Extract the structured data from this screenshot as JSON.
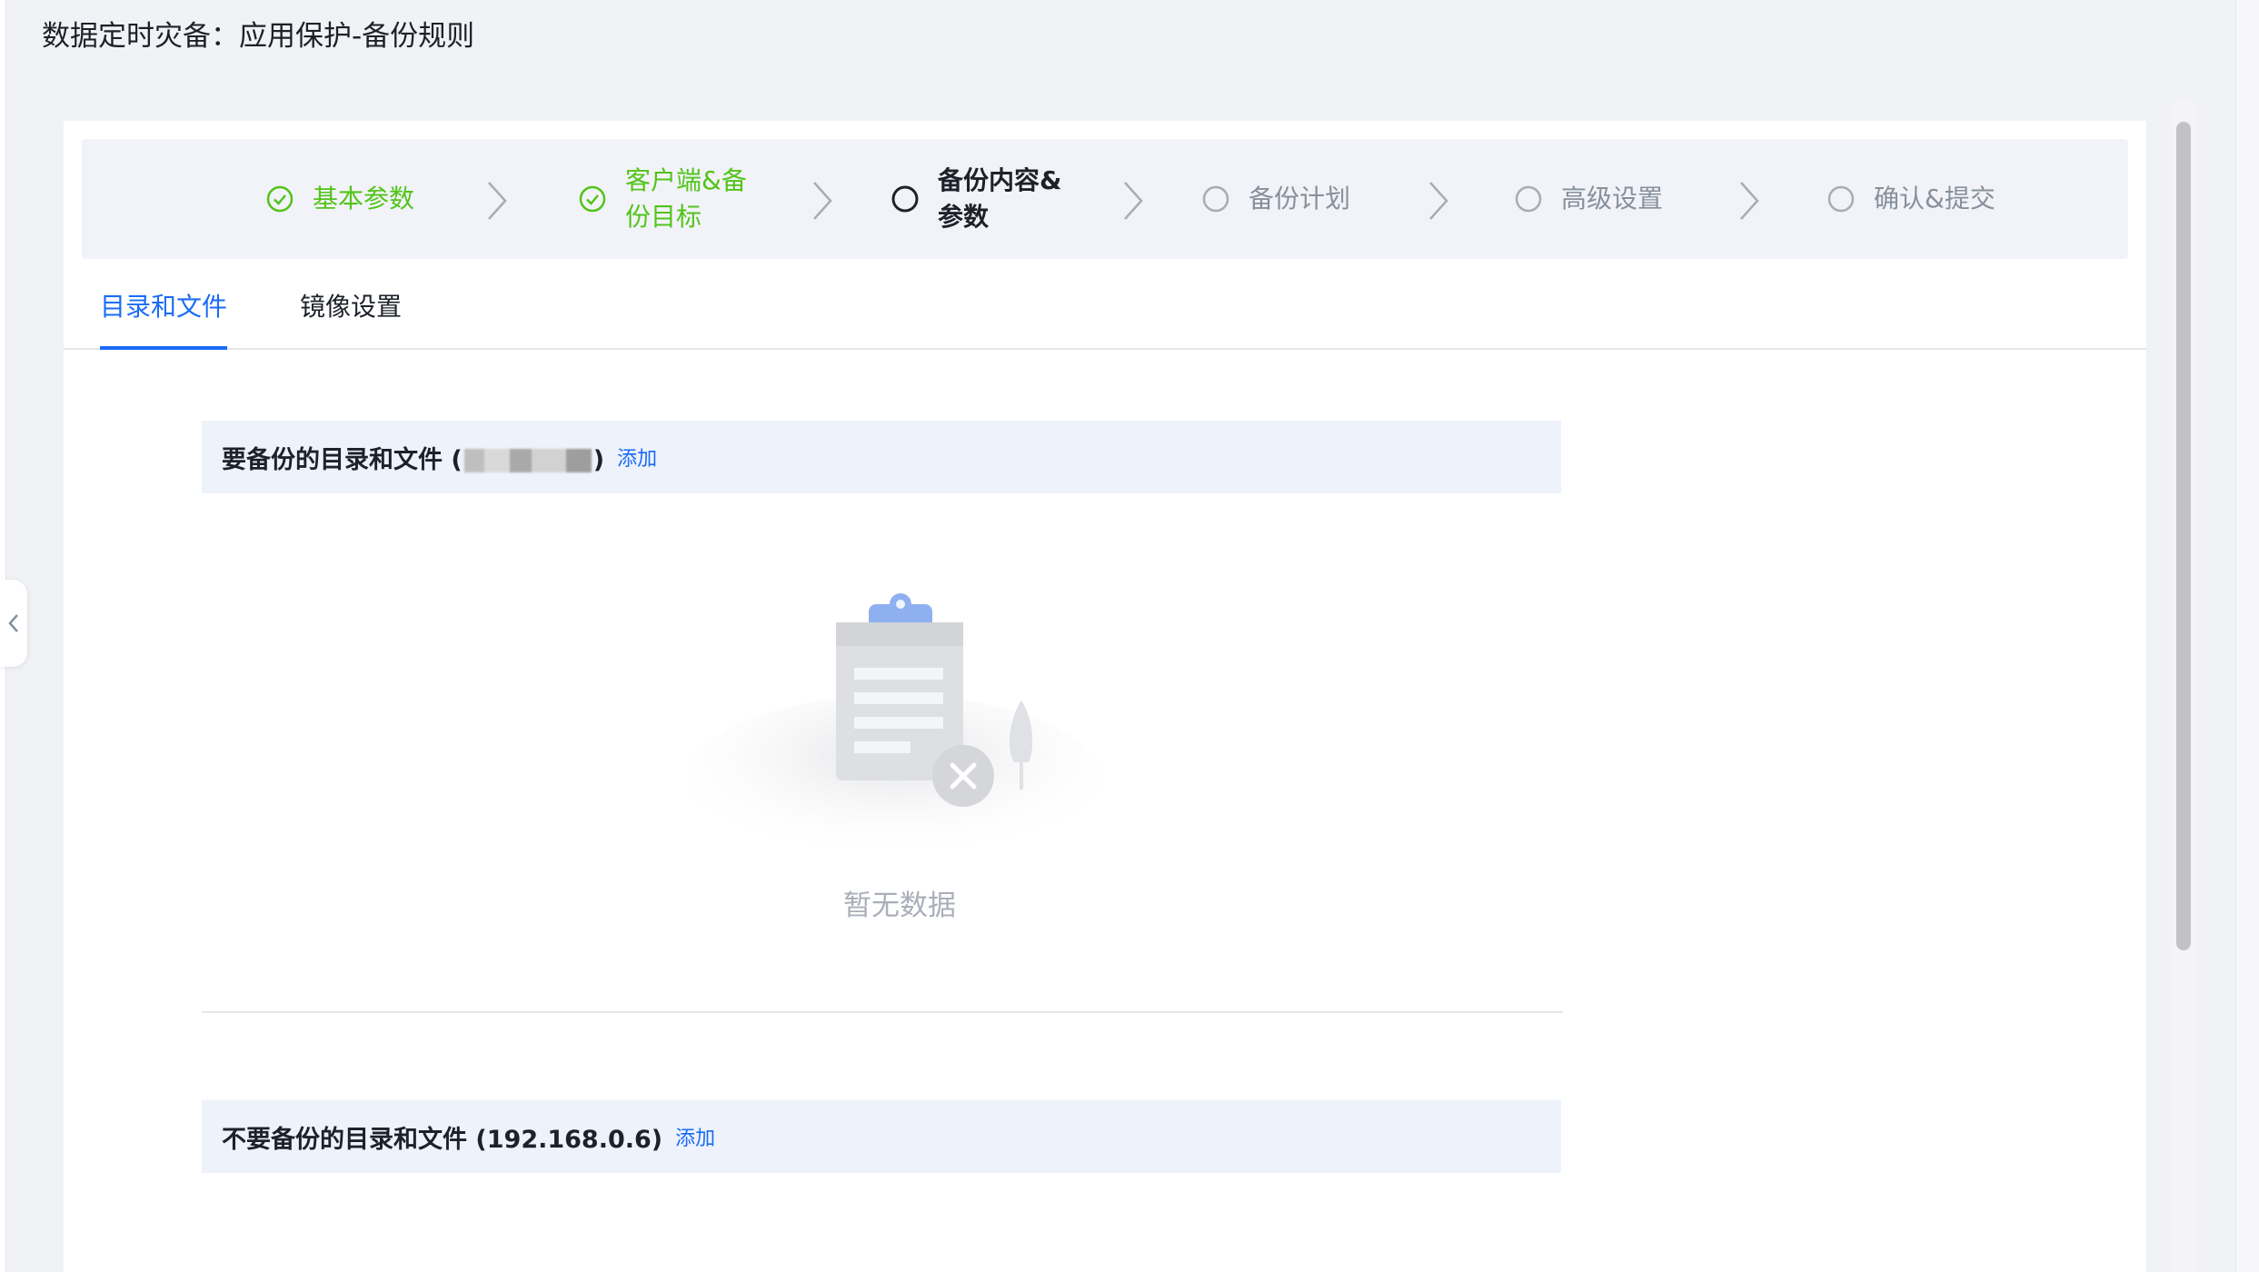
{
  "page": {
    "title": "数据定时灾备：应用保护-备份规则"
  },
  "steps": [
    {
      "label": "基本参数",
      "state": "done"
    },
    {
      "label": "客户端&备份目标",
      "state": "done"
    },
    {
      "label": "备份内容&参数",
      "state": "active"
    },
    {
      "label": "备份计划",
      "state": "pending"
    },
    {
      "label": "高级设置",
      "state": "pending"
    },
    {
      "label": "确认&提交",
      "state": "pending"
    }
  ],
  "tabs": [
    {
      "label": "目录和文件",
      "active": true
    },
    {
      "label": "镜像设置",
      "active": false
    }
  ],
  "include_section": {
    "title_prefix": "要备份的目录和文件 (",
    "title_suffix": ")",
    "add_label": "添加",
    "empty_text": "暂无数据"
  },
  "exclude_section": {
    "title": "不要备份的目录和文件 (192.168.0.6)",
    "add_label": "添加"
  },
  "colors": {
    "accent": "#1a6cf5",
    "success": "#52c41a",
    "pending": "#86909c"
  },
  "icons": {
    "done": "check-circle-icon",
    "active": "circle-icon",
    "pending": "circle-icon",
    "separator": "chevron-right-icon",
    "collapse": "chevron-left-icon"
  }
}
